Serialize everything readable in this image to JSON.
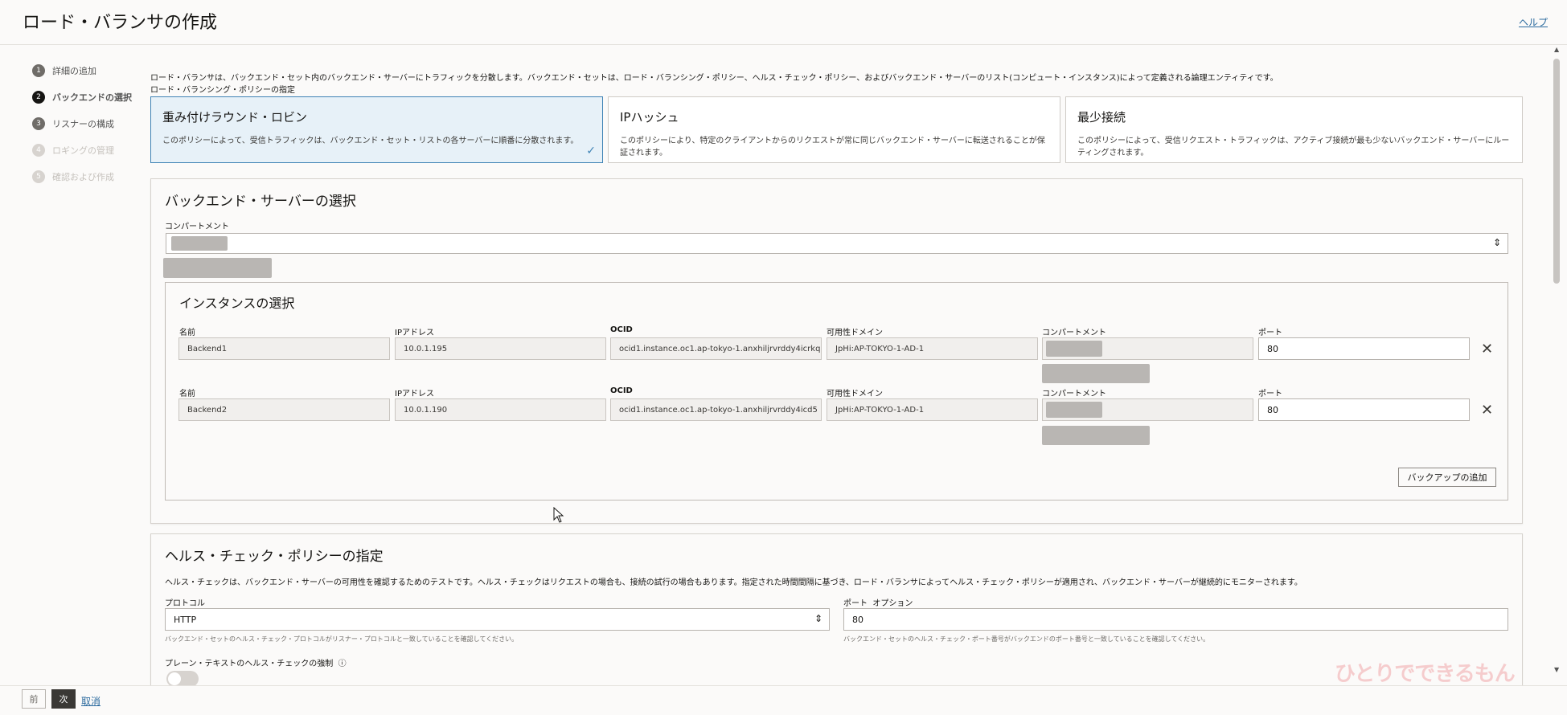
{
  "header": {
    "title": "ロード・バランサの作成",
    "help": "ヘルプ"
  },
  "steps": [
    {
      "num": "1",
      "label": "詳細の追加",
      "state": "done"
    },
    {
      "num": "2",
      "label": "バックエンドの選択",
      "state": "active"
    },
    {
      "num": "3",
      "label": "リスナーの構成",
      "state": "done"
    },
    {
      "num": "4",
      "label": "ロギングの管理",
      "state": "disabled"
    },
    {
      "num": "5",
      "label": "確認および作成",
      "state": "disabled"
    }
  ],
  "intro": {
    "text": "ロード・バランサは、バックエンド・セット内のバックエンド・サーバーにトラフィックを分散します。バックエンド・セットは、ロード・バランシング・ポリシー、ヘルス・チェック・ポリシー、およびバックエンド・サーバーのリスト(コンピュート・インスタンス)によって定義される論理エンティティです。",
    "policy_label": "ロード・バランシング・ポリシーの指定"
  },
  "policies": [
    {
      "title": "重み付けラウンド・ロビン",
      "desc": "このポリシーによって、受信トラフィックは、バックエンド・セット・リストの各サーバーに順番に分散されます。",
      "selected": true
    },
    {
      "title": "IPハッシュ",
      "desc": "このポリシーにより、特定のクライアントからのリクエストが常に同じバックエンド・サーバーに転送されることが保証されます。",
      "selected": false
    },
    {
      "title": "最少接続",
      "desc": "このポリシーによって、受信リクエスト・トラフィックは、アクティブ接続が最も少ないバックエンド・サーバーにルーティングされます。",
      "selected": false
    }
  ],
  "backend": {
    "title": "バックエンド・サーバーの選択",
    "compartment_label": "コンパートメント",
    "instances_title": "インスタンスの選択",
    "columns": {
      "name": "名前",
      "ip": "IPアドレス",
      "ocid": "OCID",
      "ad": "可用性ドメイン",
      "compartment": "コンパートメント",
      "port": "ポート"
    },
    "rows": [
      {
        "name": "Backend1",
        "ip": "10.0.1.195",
        "ocid": "ocid1.instance.oc1.ap-tokyo-1.anxhiljrvrddy4icrkq",
        "ad": "JpHi:AP-TOKYO-1-AD-1",
        "port": "80"
      },
      {
        "name": "Backend2",
        "ip": "10.0.1.190",
        "ocid": "ocid1.instance.oc1.ap-tokyo-1.anxhiljrvrddy4icd5",
        "ad": "JpHi:AP-TOKYO-1-AD-1",
        "port": "80"
      }
    ],
    "add_backup": "バックアップの追加"
  },
  "health": {
    "title": "ヘルス・チェック・ポリシーの指定",
    "desc": "ヘルス・チェックは、バックエンド・サーバーの可用性を確認するためのテストです。ヘルス・チェックはリクエストの場合も、接続の試行の場合もあります。指定された時間間隔に基づき、ロード・バランサによってヘルス・チェック・ポリシーが適用され、バックエンド・サーバーが継続的にモニターされます。",
    "protocol_label": "プロトコル",
    "protocol_value": "HTTP",
    "protocol_hint": "バックエンド・セットのヘルス・チェック・プロトコルがリスナー・プロトコルと一致していることを確認してください。",
    "port_label": "ポート",
    "port_optional": "オプション",
    "port_value": "80",
    "port_hint": "バックエンド・セットのヘルス・チェック・ポート番号がバックエンドのポート番号と一致していることを確認してください。",
    "plaintext_label": "プレーン・テキストのヘルス・チェックの強制",
    "info_icon": "ⓘ"
  },
  "footer": {
    "prev": "前",
    "next": "次",
    "cancel": "取消"
  },
  "watermark": "ひとりでできるもん"
}
